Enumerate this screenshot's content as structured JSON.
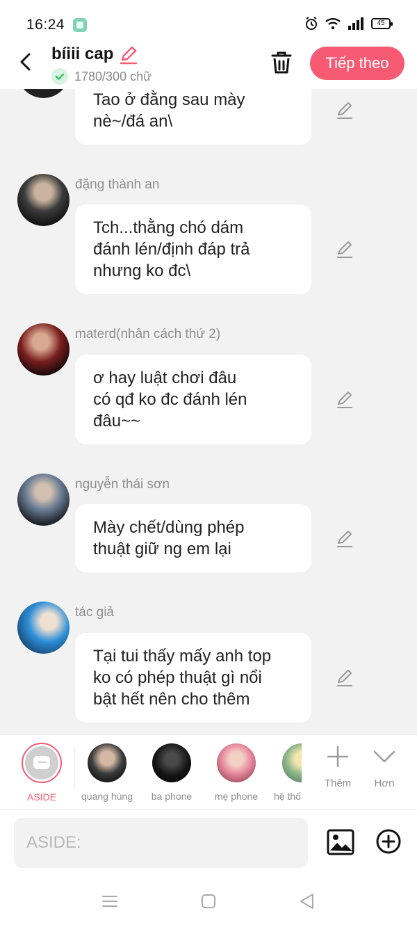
{
  "status_bar": {
    "time": "16:24",
    "battery": "45"
  },
  "header": {
    "title": "bíiii cap",
    "word_count": "1780/300 chữ",
    "next_label": "Tiếp theo"
  },
  "messages": [
    {
      "sender": "",
      "lines": [
        "Tao ở đằng sau mày",
        "nè~/đá an\\"
      ]
    },
    {
      "sender": "đặng thành an",
      "lines": [
        "Tch...thằng chó dám",
        "đánh lén/định đáp trả",
        "nhưng ko đc\\"
      ]
    },
    {
      "sender": "materd(nhân cách thứ 2)",
      "lines": [
        "ơ hay luật chơi đâu",
        "có qđ ko đc đánh lén",
        "đâu~~"
      ]
    },
    {
      "sender": "nguyễn thái sơn",
      "lines": [
        "Mày chết/dùng phép",
        "thuật giữ ng em lại"
      ]
    },
    {
      "sender": "tác giả",
      "lines": [
        "Tại tui thấy mấy anh top",
        "ko có phép thuật gì nổi",
        "bật hết nên cho thêm"
      ]
    }
  ],
  "characters": [
    {
      "label": "ASIDE"
    },
    {
      "label": "quang hùng"
    },
    {
      "label": "ba phone"
    },
    {
      "label": "mẹ phone"
    },
    {
      "label": "hệ thố"
    }
  ],
  "tools": {
    "more_label": "Thêm",
    "expand_label": "Hơn"
  },
  "input": {
    "placeholder": "ASIDE:"
  },
  "colors": {
    "accent": "#f75a73",
    "verified": "#3cc46b",
    "background": "#f2f2f2"
  }
}
